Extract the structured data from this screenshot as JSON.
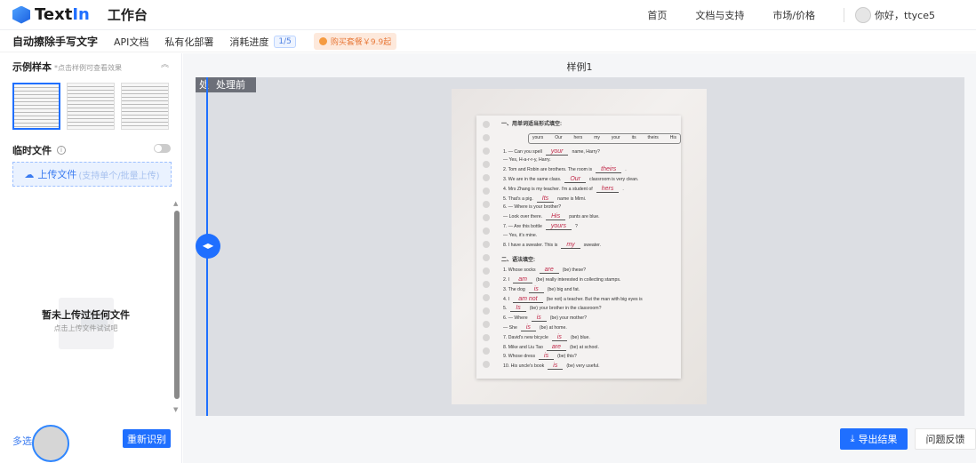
{
  "header": {
    "brand_prefix": "Text",
    "brand_suffix": "In",
    "workspace": "工作台",
    "nav": [
      "首页",
      "文档与支持",
      "市场/价格"
    ],
    "greeting": "你好，ttyce5"
  },
  "subnav": {
    "title": "自动擦除手写文字",
    "items": [
      "API文档",
      "私有化部署",
      "消耗进度"
    ],
    "usage": "1/5",
    "buy": "购买套餐￥9.9起"
  },
  "sidebar": {
    "samples_title": "示例样本",
    "samples_hint": "*点击样例可查看效果",
    "temp_title": "临时文件",
    "info": "i",
    "upload_label": "上传文件",
    "upload_hint": "(支持单个/批量上传)",
    "empty_title": "暂未上传过任何文件",
    "empty_hint": "点击上传文件试试吧",
    "multi": "多选",
    "rerun": "重新识别"
  },
  "main": {
    "title": "样例1",
    "label_after": "处",
    "label_before": "处理前",
    "export": "导出结果",
    "feedback": "问题反馈"
  },
  "document": {
    "section1": "一、用单词适当形式填空:",
    "wordbox": [
      "yours",
      "Our",
      "hers",
      "my",
      "your",
      "its",
      "theirs",
      "His"
    ],
    "lines1": [
      {
        "pre": "1. — Can you spell",
        "ans": "your",
        "post": "name, Harry?"
      },
      {
        "pre": "— Yes, H-a-r-r-y, Harry.",
        "ans": "",
        "post": ""
      },
      {
        "pre": "2. Tom and Robin are brothers. The room is",
        "ans": "theirs",
        "post": "."
      },
      {
        "pre": "3. We are in the same class.",
        "ans": "Our",
        "post": "classroom is very clean."
      },
      {
        "pre": "4. Mrs Zhang is my teacher. I'm a student of",
        "ans": "hers",
        "post": "."
      },
      {
        "pre": "5. That's a pig.",
        "ans": "Its",
        "post": "name is Mimi."
      },
      {
        "pre": "6. — Where is your brother?",
        "ans": "",
        "post": ""
      },
      {
        "pre": "— Look over there.",
        "ans": "His",
        "post": "pants are blue."
      },
      {
        "pre": "7. — Are this bottle",
        "ans": "yours",
        "post": "?"
      },
      {
        "pre": "— Yes, it's mine.",
        "ans": "",
        "post": ""
      },
      {
        "pre": "8. I have a sweater. This is",
        "ans": "my",
        "post": "sweater."
      }
    ],
    "section2": "二、语法填空:",
    "lines2": [
      {
        "pre": "1. Whose socks",
        "ans": "are",
        "post": "(be) these?"
      },
      {
        "pre": "2. I",
        "ans": "am",
        "post": "(be) really interested in collecting stamps."
      },
      {
        "pre": "3. The dog",
        "ans": "is",
        "post": "(be) big and fat."
      },
      {
        "pre": "4. I",
        "ans": "am not",
        "post": "(be not) a teacher. But the man with big eyes is"
      },
      {
        "pre": "5.",
        "ans": "Is",
        "post": "(be) your brother in the classroom?"
      },
      {
        "pre": "6. — Where",
        "ans": "is",
        "post": "(be) your mother?"
      },
      {
        "pre": "— She",
        "ans": "is",
        "post": "(be) at home."
      },
      {
        "pre": "7. David's new bicycle",
        "ans": "is",
        "post": "(be) blue."
      },
      {
        "pre": "8. Mike and Liu Tao",
        "ans": "are",
        "post": "(be) at school."
      },
      {
        "pre": "9. Whose dress",
        "ans": "is",
        "post": "(be) this?"
      },
      {
        "pre": "10. His uncle's book",
        "ans": "is",
        "post": "(be) very useful."
      }
    ]
  },
  "colors": {
    "accent": "#1f6fff",
    "handwriting": "#c22a4a"
  }
}
